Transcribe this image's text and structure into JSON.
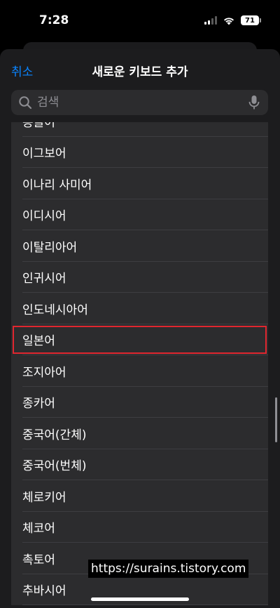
{
  "status": {
    "time": "7:28",
    "battery": "71"
  },
  "nav": {
    "cancel": "취소",
    "title": "새로운 키보드 추가"
  },
  "search": {
    "placeholder": "검색"
  },
  "languages": [
    "몽골어",
    "이그보어",
    "이나리 사미어",
    "이디시어",
    "이탈리아어",
    "인귀시어",
    "인도네시아어",
    "일본어",
    "조지아어",
    "종카어",
    "중국어(간체)",
    "중국어(번체)",
    "체로키어",
    "체코어",
    "촉토어",
    "추바시어"
  ],
  "highlighted_language": "일본어",
  "watermark": "https://surains.tistory.com",
  "colors": {
    "accent": "#0a84ff",
    "highlight": "#e0262f",
    "row_bg": "#2c2c2e",
    "sheet_bg": "#1c1c1e"
  }
}
